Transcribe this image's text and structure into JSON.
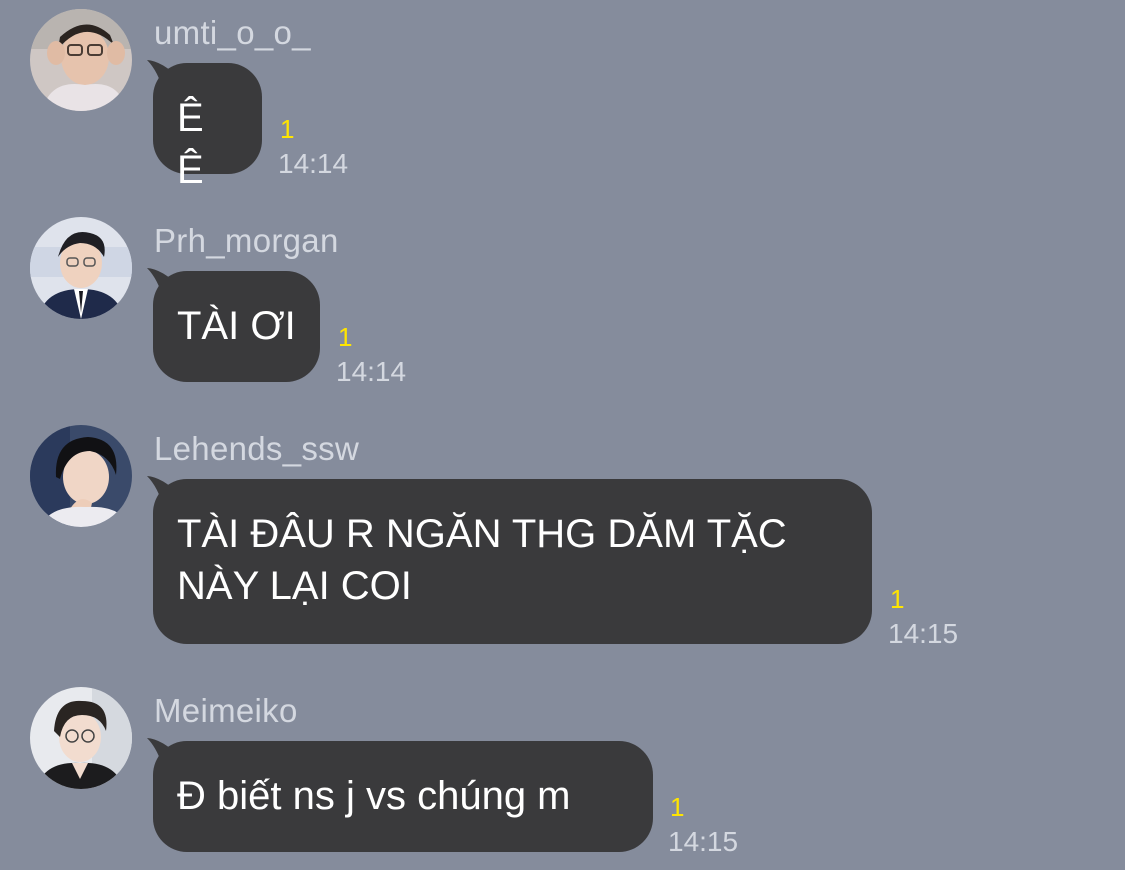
{
  "messages": [
    {
      "sender": "umti_o_o_",
      "text": "Ê Ê",
      "read_count": "1",
      "time": "14:14"
    },
    {
      "sender": "Prh_morgan",
      "text": "TÀI ƠI",
      "read_count": "1",
      "time": "14:14"
    },
    {
      "sender": "Lehends_ssw",
      "text": "TÀI ĐÂU R NGĂN THG DĂM TẶC\nNÀY LẠI COI",
      "read_count": "1",
      "time": "14:15"
    },
    {
      "sender": "Meimeiko",
      "text": "Đ biết ns j vs chúng m",
      "read_count": "1",
      "time": "14:15"
    }
  ],
  "colors": {
    "background": "#858c9c",
    "bubble": "#3a3a3c",
    "bubble_text": "#ffffff",
    "sender_name": "#d4d8e0",
    "read_count": "#ffe500",
    "time": "#d4d8e0"
  }
}
